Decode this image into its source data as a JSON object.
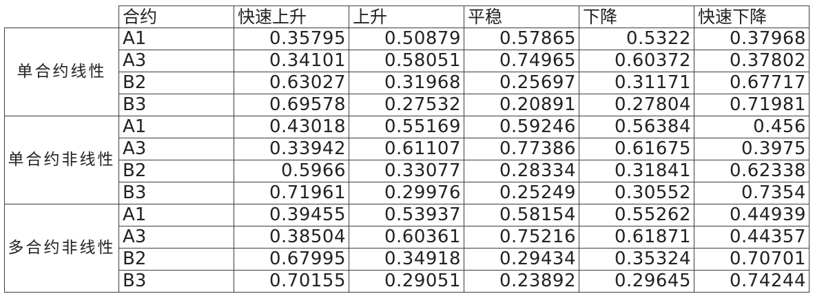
{
  "header": {
    "code_label": "合约",
    "columns": [
      "快速上升",
      "上升",
      "平稳",
      "下降",
      "快速下降"
    ]
  },
  "groups": [
    {
      "name": "单合约线性",
      "rows": [
        {
          "code": "A1",
          "values": [
            "0.35795",
            "0.50879",
            "0.57865",
            "0.5322",
            "0.37968"
          ]
        },
        {
          "code": "A3",
          "values": [
            "0.34101",
            "0.58051",
            "0.74965",
            "0.60372",
            "0.37802"
          ]
        },
        {
          "code": "B2",
          "values": [
            "0.63027",
            "0.31968",
            "0.25697",
            "0.31171",
            "0.67717"
          ]
        },
        {
          "code": "B3",
          "values": [
            "0.69578",
            "0.27532",
            "0.20891",
            "0.27804",
            "0.71981"
          ]
        }
      ]
    },
    {
      "name": "单合约非线性",
      "rows": [
        {
          "code": "A1",
          "values": [
            "0.43018",
            "0.55169",
            "0.59246",
            "0.56384",
            "0.456"
          ]
        },
        {
          "code": "A3",
          "values": [
            "0.33942",
            "0.61107",
            "0.77386",
            "0.61675",
            "0.3975"
          ]
        },
        {
          "code": "B2",
          "values": [
            "0.5966",
            "0.33077",
            "0.28334",
            "0.31841",
            "0.62338"
          ]
        },
        {
          "code": "B3",
          "values": [
            "0.71961",
            "0.29976",
            "0.25249",
            "0.30552",
            "0.7354"
          ]
        }
      ]
    },
    {
      "name": "多合约非线性",
      "rows": [
        {
          "code": "A1",
          "values": [
            "0.39455",
            "0.53937",
            "0.58154",
            "0.55262",
            "0.44939"
          ]
        },
        {
          "code": "A3",
          "values": [
            "0.38504",
            "0.60361",
            "0.75216",
            "0.61871",
            "0.44357"
          ]
        },
        {
          "code": "B2",
          "values": [
            "0.67995",
            "0.34918",
            "0.29434",
            "0.35324",
            "0.70701"
          ]
        },
        {
          "code": "B3",
          "values": [
            "0.70155",
            "0.29051",
            "0.23892",
            "0.29645",
            "0.74244"
          ]
        }
      ]
    }
  ]
}
